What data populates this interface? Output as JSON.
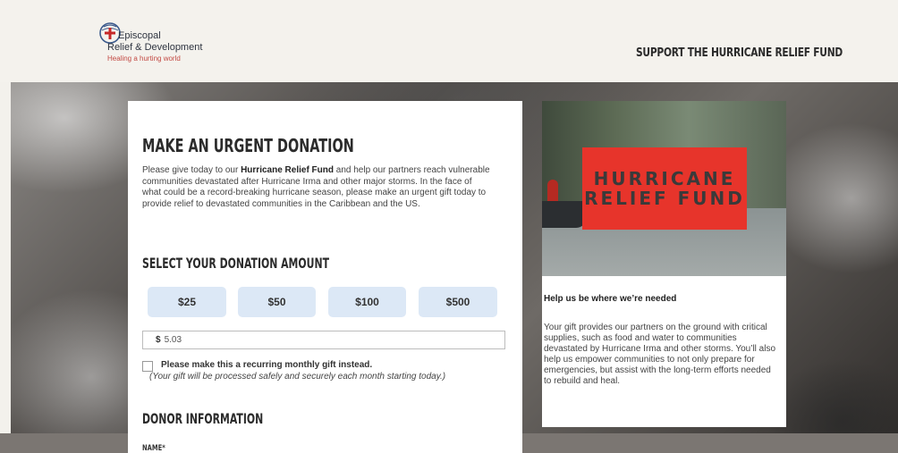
{
  "header": {
    "org_line1": "Episcopal",
    "org_line2": "Relief & Development",
    "tagline": "Healing a hurting world",
    "cta": "SUPPORT THE HURRICANE RELIEF FUND"
  },
  "form": {
    "title": "MAKE AN URGENT DONATION",
    "intro_pre": "Please give today to our ",
    "intro_bold": "Hurricane Relief Fund",
    "intro_post": " and help our partners reach vulnerable communities devastated after Hurricane Irma and other major storms. In the face of what could be a record-breaking hurricane season, please make an urgent gift today to provide relief to devastated communities in the Caribbean and the US.",
    "amount_title": "SELECT YOUR DONATION AMOUNT",
    "amounts": [
      "$25",
      "$50",
      "$100",
      "$500"
    ],
    "currency_symbol": "$",
    "other_amount_value": "5.03",
    "recurring_label": "Please make this a recurring monthly gift instead.",
    "recurring_note": "(Your gift will be processed safely and securely each month starting today.)",
    "donor_title": "DONOR INFORMATION",
    "name_label": "NAME*"
  },
  "side": {
    "banner_line1": "HURRICANE",
    "banner_line2": "RELIEF FUND",
    "heading": "Help us be where we’re needed",
    "text": "Your gift provides our partners on the ground with critical supplies, such as food and water to communities devastated by Hurricane Irma and other storms. You’ll also help us empower communities to not only prepare for emergencies, but assist with the long-term efforts needed to rebuild and heal."
  },
  "colors": {
    "banner_red": "#e7342b",
    "amount_button_bg": "#dce8f6",
    "tagline_red": "#c34a44"
  },
  "icons": {
    "logo": "shield-cross-logo-icon",
    "checkbox": "checkbox-unchecked-icon"
  }
}
